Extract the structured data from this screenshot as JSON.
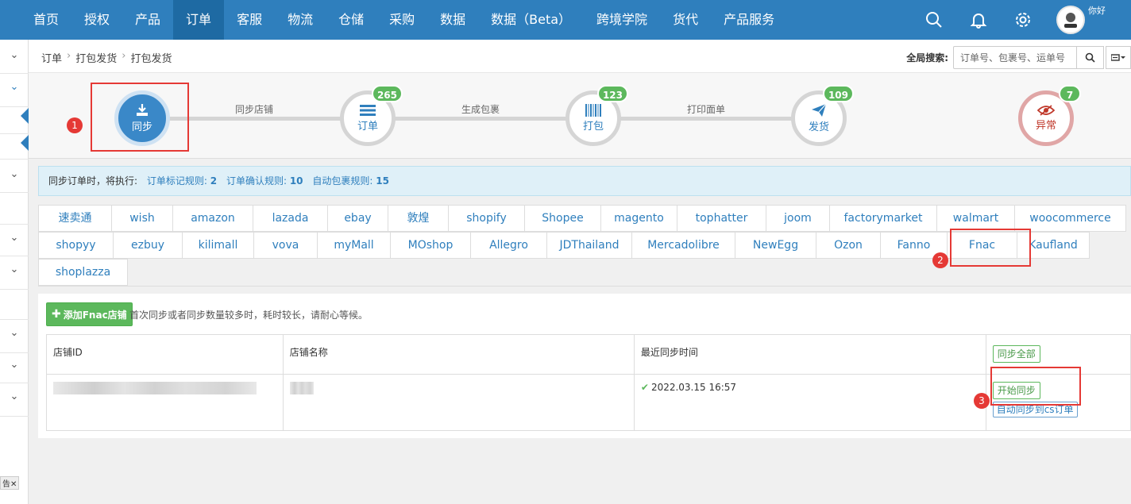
{
  "nav": {
    "items": [
      "首页",
      "授权",
      "产品",
      "订单",
      "客服",
      "物流",
      "仓储",
      "采购",
      "数据",
      "数据（Beta）",
      "跨境学院",
      "货代",
      "产品服务"
    ],
    "active_index": 3,
    "username": "你好"
  },
  "sidebar": {
    "ad_label": "告✕"
  },
  "breadcrumb": {
    "items": [
      "订单",
      "打包发货",
      "打包发货"
    ],
    "separator": "›"
  },
  "search": {
    "label": "全局搜索:",
    "placeholder": "订单号、包裹号、运单号"
  },
  "workflow": {
    "nodes": [
      {
        "label": "同步",
        "icon": "download-icon",
        "badge": ""
      },
      {
        "label": "订单",
        "icon": "list-icon",
        "badge": "265"
      },
      {
        "label": "打包",
        "icon": "barcode-icon",
        "badge": "123"
      },
      {
        "label": "发货",
        "icon": "paper-plane-icon",
        "badge": "109"
      },
      {
        "label": "异常",
        "icon": "eye-slash-icon",
        "badge": "7"
      }
    ],
    "links": [
      "同步店铺",
      "生成包裹",
      "打印面单"
    ]
  },
  "steps": [
    "1",
    "2",
    "3"
  ],
  "info": {
    "prefix": "同步订单时，将执行:",
    "rules": [
      {
        "label": "订单标记规则:",
        "value": "2"
      },
      {
        "label": "订单确认规则:",
        "value": "10"
      },
      {
        "label": "自动包裹规则:",
        "value": "15"
      }
    ]
  },
  "platforms": {
    "row1": [
      "速卖通",
      "wish",
      "amazon",
      "lazada",
      "ebay",
      "敦煌",
      "shopify",
      "Shopee",
      "magento",
      "tophatter",
      "joom",
      "factorymarket",
      "walmart",
      "woocommerce"
    ],
    "row2": [
      "shopyy",
      "ezbuy",
      "kilimall",
      "vova",
      "myMall",
      "MOshop",
      "Allegro",
      "JDThailand",
      "Mercadolibre",
      "NewEgg",
      "Ozon",
      "Fanno",
      "Fnac",
      "Kaufland"
    ],
    "row3": [
      "shoplazza"
    ],
    "active": "Fnac"
  },
  "store": {
    "add_button": "添加Fnac店铺",
    "hint": "首次同步或者同步数量较多时，耗时较长，请耐心等候。",
    "columns": [
      "店铺ID",
      "店铺名称",
      "最近同步时间"
    ],
    "sync_all": "同步全部",
    "rows": [
      {
        "last_sync": "2022.03.15 16:57",
        "start_sync": "开始同步",
        "auto_sync": "自动同步到cs订单"
      }
    ]
  }
}
